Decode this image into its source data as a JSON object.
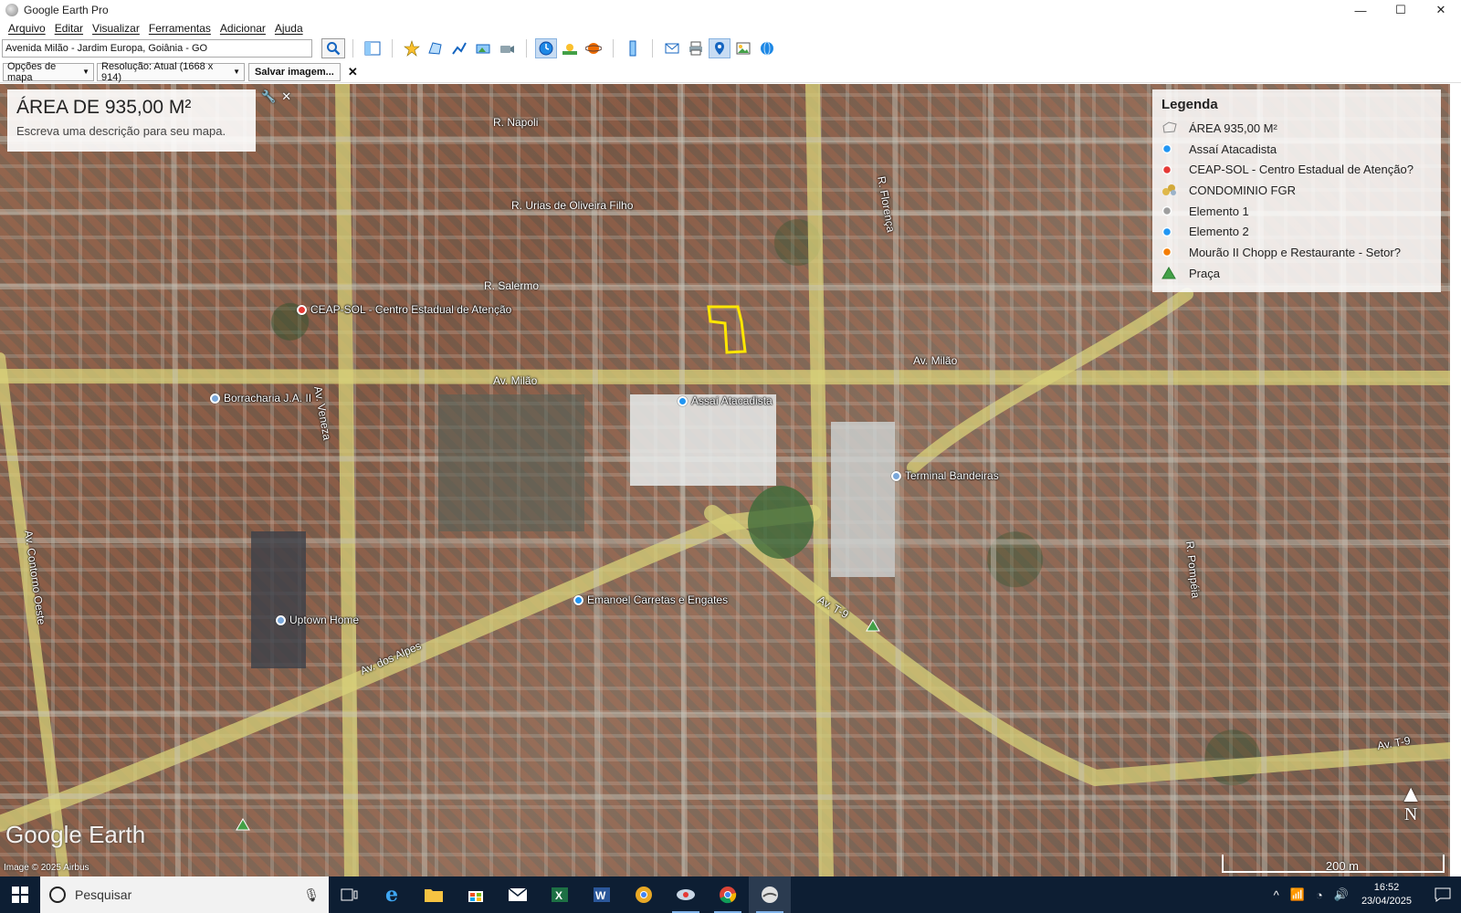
{
  "window": {
    "title": "Google Earth Pro",
    "minimize": "—",
    "maximize": "☐",
    "close": "✕"
  },
  "menu": [
    "Arquivo",
    "Editar",
    "Visualizar",
    "Ferramentas",
    "Adicionar",
    "Ajuda"
  ],
  "toolbar": {
    "search_value": "Avenida Milão - Jardim Europa, Goiânia - GO"
  },
  "print_bar": {
    "map_options": "Opções de mapa",
    "resolution": "Resolução: Atual (1668 x 914)",
    "save": "Salvar imagem...",
    "close": "✕"
  },
  "map": {
    "title": "ÁREA DE 935,00 M²",
    "description": "Escreva uma descrição para seu mapa.",
    "google_earth": "Google Earth",
    "attribution": "Image © 2025 Airbus",
    "scale": "200 m",
    "north": "N",
    "roads": [
      "R. Napoli",
      "R. Urias de Oliveira Filho",
      "R. Salermo",
      "Av. Milão",
      "Av. Milão",
      "Av. Veneza",
      "Av. dos Alpes",
      "Av. T-9",
      "Av. T-9",
      "R. Florença",
      "R. Pompéia",
      "Av. Contorno Oeste"
    ],
    "pins": [
      {
        "label": "CEAP-SOL - Centro Estadual de Atenção",
        "color": "#e53935"
      },
      {
        "label": "Borracharia J.A. II",
        "color": "#7aa7d9"
      },
      {
        "label": "Assaí Atacadista",
        "color": "#2196f3"
      },
      {
        "label": "Terminal Bandeiras",
        "color": "#7aa7d9"
      },
      {
        "label": "Emanoel Carretas e Engates",
        "color": "#2196f3"
      },
      {
        "label": "Uptown Home",
        "color": "#7aa7d9"
      }
    ]
  },
  "legend": {
    "title": "Legenda",
    "items": [
      {
        "label": "ÁREA 935,00 M²",
        "icon": "polygon-icon"
      },
      {
        "label": "Assaí Atacadista",
        "icon": "blue-pin-icon",
        "color": "#2196f3"
      },
      {
        "label": "CEAP-SOL - Centro Estadual de Atenção?",
        "icon": "hospital-pin-icon",
        "color": "#e53935"
      },
      {
        "label": "CONDOMINIO FGR",
        "icon": "buildings-icon",
        "color": "#e0b84a"
      },
      {
        "label": "Elemento 1",
        "icon": "gray-pin-icon",
        "color": "#9e9e9e"
      },
      {
        "label": "Elemento 2",
        "icon": "blue-pin-icon",
        "color": "#2196f3"
      },
      {
        "label": "Mourão II Chopp e Restaurante - Setor?",
        "icon": "orange-pin-icon",
        "color": "#f57c00"
      },
      {
        "label": "Praça",
        "icon": "park-icon",
        "color": "#43a047"
      }
    ]
  },
  "taskbar": {
    "search_placeholder": "Pesquisar",
    "time": "16:52",
    "date": "23/04/2025"
  }
}
